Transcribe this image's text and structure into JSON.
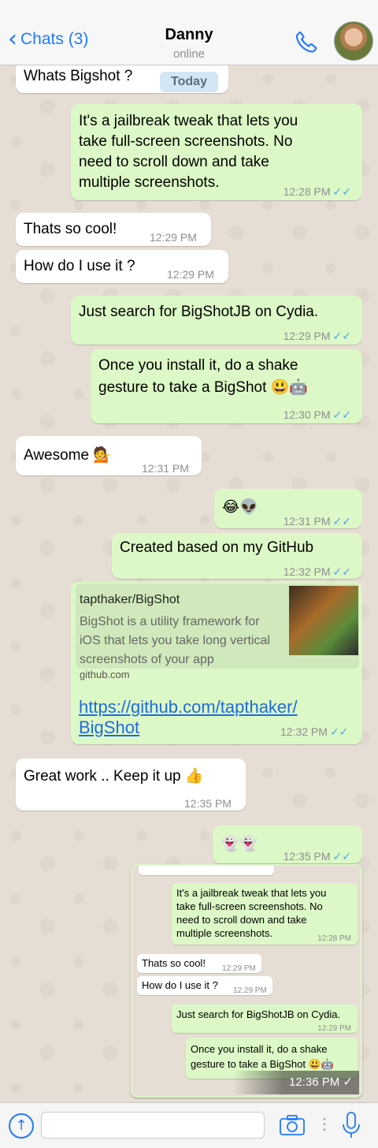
{
  "header": {
    "back_label": "Chats (3)",
    "contact_name": "Danny",
    "status": "online"
  },
  "day_badge": "Today",
  "messages": [
    {
      "dir": "in",
      "text": "Whats Bigshot ?",
      "time": ""
    },
    {
      "dir": "out",
      "lines": [
        "It's a jailbreak tweak that lets you",
        "take full-screen screenshots. No",
        "need to scroll down and take",
        "multiple screenshots."
      ],
      "time": "12:28 PM"
    },
    {
      "dir": "in",
      "text": "Thats so cool!",
      "time": "12:29 PM"
    },
    {
      "dir": "in",
      "text": "How do I use it ?",
      "time": "12:29 PM"
    },
    {
      "dir": "out",
      "text": "Just search for BigShotJB on Cydia.",
      "time": "12:29 PM"
    },
    {
      "dir": "out",
      "lines": [
        "Once you install it, do a shake",
        "gesture to take a BigShot 😃🤖"
      ],
      "time": "12:30 PM"
    },
    {
      "dir": "in",
      "text": "Awesome 💁",
      "time": "12:31 PM"
    },
    {
      "dir": "out",
      "text": "😂👽",
      "time": "12:31 PM"
    },
    {
      "dir": "out",
      "text": "Created based on my GitHub",
      "time": "12:32 PM"
    },
    {
      "dir": "out",
      "link_title": "tapthaker/BigShot",
      "link_desc": "BigShot is a utility framework for iOS that lets you take long vertical screenshots of your app",
      "link_host": "github.com",
      "url_lines": [
        "https://github.com/tapthaker/",
        "BigShot"
      ],
      "time": "12:32 PM"
    },
    {
      "dir": "in",
      "text": "Great work .. Keep it up 👍",
      "time": "12:35 PM"
    },
    {
      "dir": "out",
      "text": "👻👻",
      "time": "12:35 PM"
    }
  ],
  "screenshot_preview": {
    "m1_lines": [
      "It's a jailbreak tweak that lets you",
      "take full-screen screenshots. No",
      "need to scroll down and take",
      "multiple screenshots."
    ],
    "m1_time": "12:28 PM",
    "m2": "Thats so cool!",
    "m2_time": "12:29 PM",
    "m3": "How do I use it ?",
    "m3_time": "12:29 PM",
    "m4": "Just search for BigShotJB on Cydia.",
    "m4_time": "12:29 PM",
    "m5_lines": [
      "Once you install it, do a shake",
      "gesture to take a BigShot 😃🤖"
    ],
    "time": "12:36 PM ✓"
  },
  "input": {
    "placeholder": ""
  },
  "colors": {
    "accent": "#1f7aff",
    "outgoing": "#dcf8c6",
    "incoming": "#ffffff",
    "ticks": "#4aa3f0"
  }
}
